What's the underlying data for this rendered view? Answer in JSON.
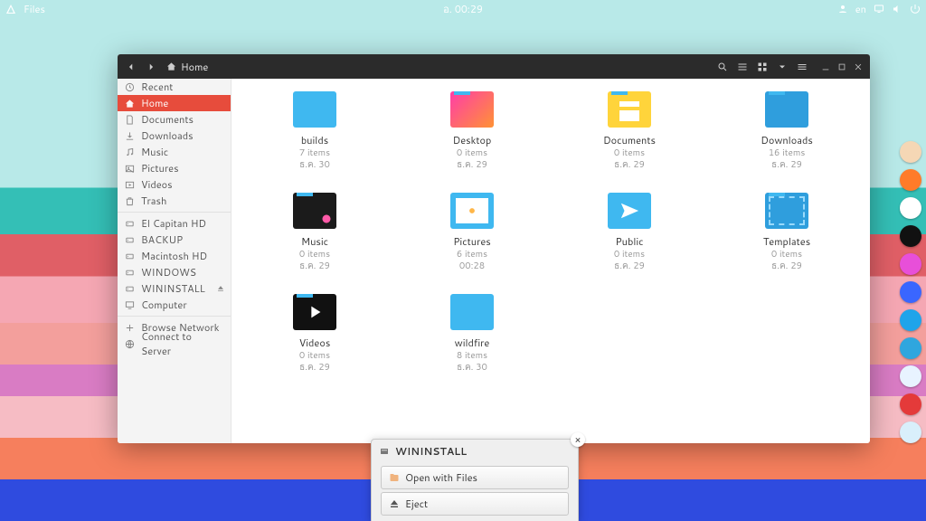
{
  "topbar": {
    "app": "Files",
    "clock": "อ. 00:29",
    "lang": "en"
  },
  "window": {
    "crumb": "Home"
  },
  "sidebar": [
    {
      "icon": "clock",
      "label": "Recent",
      "active": false
    },
    {
      "icon": "home",
      "label": "Home",
      "active": true
    },
    {
      "icon": "doc",
      "label": "Documents",
      "active": false
    },
    {
      "icon": "download",
      "label": "Downloads",
      "active": false
    },
    {
      "icon": "music",
      "label": "Music",
      "active": false
    },
    {
      "icon": "pic",
      "label": "Pictures",
      "active": false
    },
    {
      "icon": "video",
      "label": "Videos",
      "active": false
    },
    {
      "icon": "trash",
      "label": "Trash",
      "active": false
    },
    {
      "icon": "drive",
      "label": "El Capitan HD",
      "active": false,
      "group": "dev"
    },
    {
      "icon": "drive",
      "label": "BACKUP",
      "active": false,
      "group": "dev"
    },
    {
      "icon": "drive",
      "label": "Macintosh HD",
      "active": false,
      "group": "dev"
    },
    {
      "icon": "drive",
      "label": "WINDOWS",
      "active": false,
      "group": "dev"
    },
    {
      "icon": "drive",
      "label": "WININSTALL",
      "active": false,
      "group": "dev",
      "eject": true
    },
    {
      "icon": "computer",
      "label": "Computer",
      "active": false,
      "group": "dev"
    },
    {
      "icon": "network",
      "label": "Browse Network",
      "active": false,
      "group": "net"
    },
    {
      "icon": "server",
      "label": "Connect to Server",
      "active": false,
      "group": "net"
    }
  ],
  "files": [
    {
      "name": "builds",
      "meta1": "7 items",
      "meta2": "ธ.ค. 30",
      "thumb": "plain"
    },
    {
      "name": "Desktop",
      "meta1": "0 items",
      "meta2": "ธ.ค. 29",
      "thumb": "desktop"
    },
    {
      "name": "Documents",
      "meta1": "0 items",
      "meta2": "ธ.ค. 29",
      "thumb": "docs"
    },
    {
      "name": "Downloads",
      "meta1": "16 items",
      "meta2": "ธ.ค. 29",
      "thumb": "down"
    },
    {
      "name": "Music",
      "meta1": "0 items",
      "meta2": "ธ.ค. 29",
      "thumb": "music"
    },
    {
      "name": "Pictures",
      "meta1": "6 items",
      "meta2": "00:28",
      "thumb": "pics"
    },
    {
      "name": "Public",
      "meta1": "0 items",
      "meta2": "ธ.ค. 29",
      "thumb": "pub"
    },
    {
      "name": "Templates",
      "meta1": "0 items",
      "meta2": "ธ.ค. 29",
      "thumb": "tmpl"
    },
    {
      "name": "Videos",
      "meta1": "0 items",
      "meta2": "ธ.ค. 29",
      "thumb": "vid"
    },
    {
      "name": "wildfire",
      "meta1": "8 items",
      "meta2": "ธ.ค. 30",
      "thumb": "plain"
    }
  ],
  "popup": {
    "title": "WININSTALL",
    "open": "Open with Files",
    "eject": "Eject"
  },
  "dock": [
    {
      "name": "files",
      "color": "#f5d7b5"
    },
    {
      "name": "firefox",
      "color": "#ff7b29"
    },
    {
      "name": "chrome",
      "color": "#ffffff"
    },
    {
      "name": "terminal",
      "color": "#111111"
    },
    {
      "name": "app-pink",
      "color": "#e84fd9"
    },
    {
      "name": "app-blue",
      "color": "#3a66ff"
    },
    {
      "name": "skype",
      "color": "#1fa4ea"
    },
    {
      "name": "telegram",
      "color": "#2fa6de"
    },
    {
      "name": "safari",
      "color": "#e8f3ff"
    },
    {
      "name": "app-red",
      "color": "#e43a3a"
    },
    {
      "name": "chromium",
      "color": "#d9effb"
    }
  ]
}
